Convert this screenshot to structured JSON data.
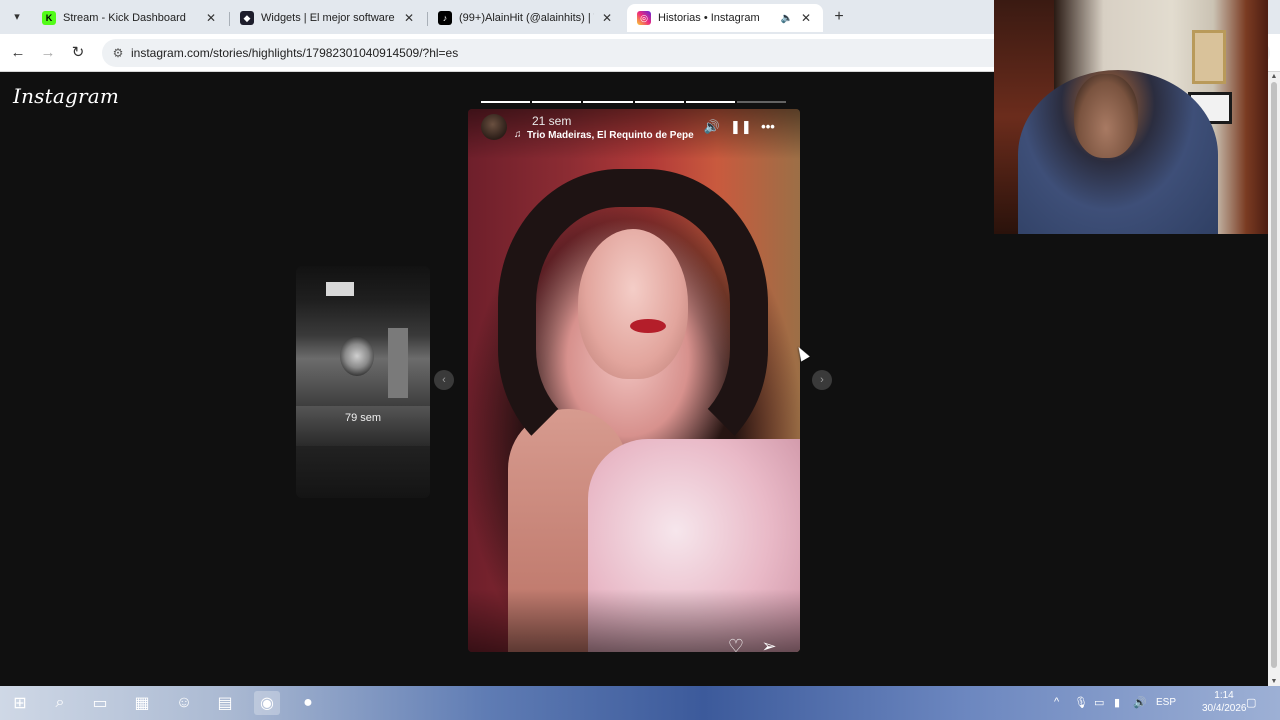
{
  "browser": {
    "tabs": [
      {
        "title": "Stream - Kick Dashboard",
        "favicon": "kick-favicon",
        "active": false
      },
      {
        "title": "Widgets | El mejor software par",
        "favicon": "streamelements-favicon",
        "active": false
      },
      {
        "title": "(99+)AlainHit (@alainhits) | TikT",
        "favicon": "tiktok-favicon",
        "active": false
      },
      {
        "title": "Historias • Instagram",
        "favicon": "instagram-favicon",
        "active": true
      }
    ],
    "url": "instagram.com/stories/highlights/17982301040914509/?hl=es"
  },
  "page": {
    "logo": "Instagram",
    "preview": {
      "time": "79 sem"
    },
    "story": {
      "time": "21 sem",
      "song": "Trio Madeiras, El Requinto de Pepe M",
      "progress": {
        "total": 6,
        "current": 6
      }
    }
  },
  "taskbar": {
    "lang": "ESP",
    "time": "1:14",
    "date": "30/4/2026"
  },
  "colors": {
    "tabstrip": "#e3e8ee",
    "page_bg": "#101010",
    "accent": "#ffffff"
  }
}
